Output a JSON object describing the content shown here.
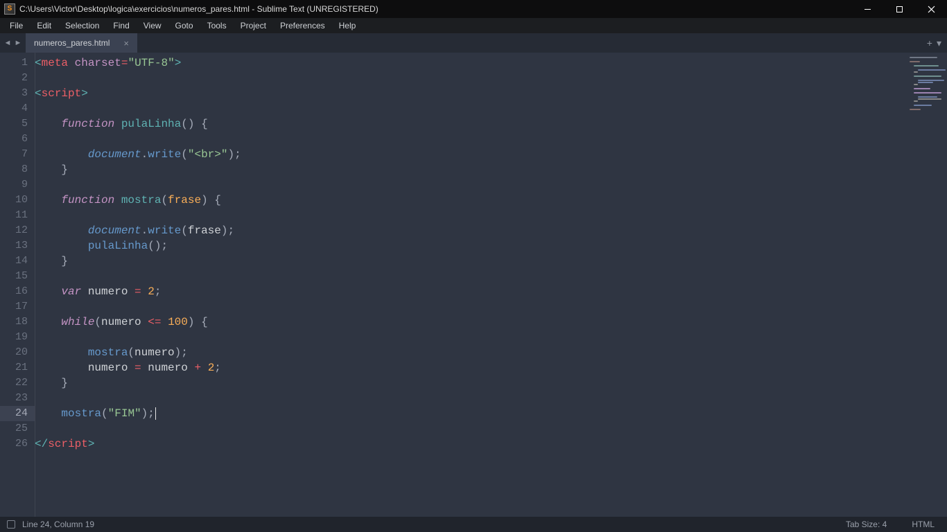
{
  "window": {
    "title": "C:\\Users\\Victor\\Desktop\\logica\\exercicios\\numeros_pares.html - Sublime Text (UNREGISTERED)"
  },
  "menu": [
    "File",
    "Edit",
    "Selection",
    "Find",
    "View",
    "Goto",
    "Tools",
    "Project",
    "Preferences",
    "Help"
  ],
  "tabs": {
    "active": {
      "label": "numeros_pares.html"
    }
  },
  "editor": {
    "line_count": 26,
    "current_line": 24,
    "code": {
      "l1": {
        "angle1": "<",
        "tag": "meta",
        "sp": " ",
        "attr": "charset",
        "eq": "=",
        "q1": "\"",
        "str": "UTF-8",
        "q2": "\"",
        "angle2": ">"
      },
      "l3": {
        "angle1": "<",
        "tag": "script",
        "angle2": ">"
      },
      "l5": {
        "kw": "function",
        "sp": " ",
        "name": "pulaLinha",
        "op": "(",
        "cp": ")",
        "sp2": " ",
        "brace": "{"
      },
      "l7": {
        "obj": "document",
        "dot": ".",
        "call": "write",
        "op": "(",
        "q1": "\"",
        "str": "<br>",
        "q2": "\"",
        "cp": ")",
        "semi": ";"
      },
      "l8": {
        "brace": "}"
      },
      "l10": {
        "kw": "function",
        "sp": " ",
        "name": "mostra",
        "op": "(",
        "param": "frase",
        "cp": ")",
        "sp2": " ",
        "brace": "{"
      },
      "l12": {
        "obj": "document",
        "dot": ".",
        "call": "write",
        "op": "(",
        "arg": "frase",
        "cp": ")",
        "semi": ";"
      },
      "l13": {
        "call": "pulaLinha",
        "op": "(",
        "cp": ")",
        "semi": ";"
      },
      "l14": {
        "brace": "}"
      },
      "l16": {
        "kw": "var",
        "sp": " ",
        "name": "numero",
        "sp2": " ",
        "eq": "=",
        "sp3": " ",
        "num": "2",
        "semi": ";"
      },
      "l18": {
        "kw": "while",
        "op": "(",
        "arg": "numero",
        "sp": " ",
        "cmp": "<=",
        "sp2": " ",
        "num": "100",
        "cp": ")",
        "sp3": " ",
        "brace": "{"
      },
      "l20": {
        "call": "mostra",
        "op": "(",
        "arg": "numero",
        "cp": ")",
        "semi": ";"
      },
      "l21": {
        "lhs": "numero",
        "sp": " ",
        "eq": "=",
        "sp2": " ",
        "rhsA": "numero",
        "sp3": " ",
        "plus": "+",
        "sp4": " ",
        "num": "2",
        "semi": ";"
      },
      "l22": {
        "brace": "}"
      },
      "l24": {
        "call": "mostra",
        "op": "(",
        "q1": "\"",
        "str": "FIM",
        "q2": "\"",
        "cp": ")",
        "semi": ";"
      },
      "l26": {
        "angle1": "</",
        "tag": "script",
        "angle2": ">"
      }
    }
  },
  "status": {
    "left": "Line 24, Column 19",
    "tab_size": "Tab Size: 4",
    "syntax": "HTML"
  }
}
